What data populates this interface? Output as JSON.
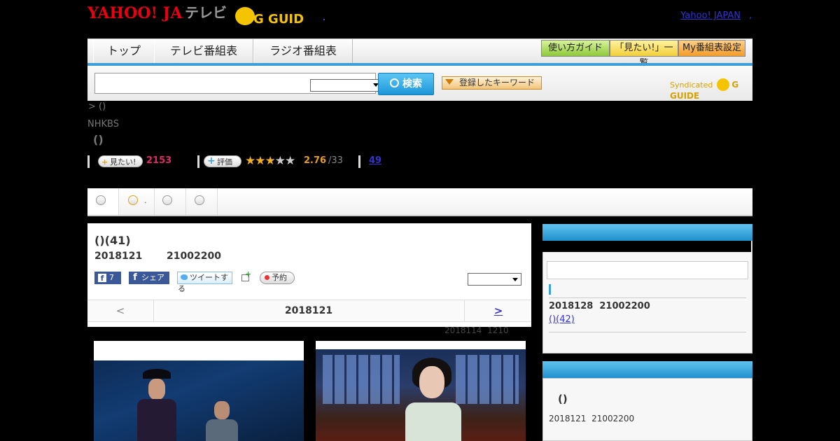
{
  "header": {
    "yahoo_logo": "YAHOO! JAPAN",
    "tv_label": "テレビ",
    "gguide_logo": "G GUIDE",
    "yahoo_japan_link": "Yahoo! JAPAN",
    "comma": ","
  },
  "nav": {
    "tabs": [
      {
        "label": "トップ"
      },
      {
        "label": "テレビ番組表"
      },
      {
        "label": "ラジオ番組表"
      }
    ],
    "guide_buttons": [
      {
        "label": "使い方ガイド"
      },
      {
        "label": "「見たい!」一覧"
      },
      {
        "label": "My番組表設定"
      }
    ]
  },
  "search": {
    "button_label": "検索",
    "keyword_button": "登録したキーワード",
    "syndicated": "Syndicated"
  },
  "breadcrumb": ">  ()",
  "channel": "NHKBS",
  "program_title": "()",
  "rating": {
    "mitai_label": "見たい!",
    "mitai_count": "2153",
    "hyoka_label": "評価",
    "stars": "★★★★★",
    "score": "2.76",
    "score_count": "/33",
    "review_count": "49"
  },
  "tabs_row": {
    "tab2_text": "."
  },
  "episode": {
    "title": "()(41)",
    "date": "2018121",
    "time": "21002200",
    "fb_like_count": "7",
    "fb_share_label": "シェア",
    "tweet_label": "ツイートする",
    "reserve_label": "予約",
    "prev": "<",
    "current_date": "2018121",
    "next": ">",
    "updated_date": "2018114",
    "updated_time": "1210"
  },
  "sidebar": {
    "next_date": "2018128",
    "next_time": "21002200",
    "next_link": "()(42)",
    "program_title": "()",
    "program_date": "2018121",
    "program_time": "21002200"
  },
  "colors": {
    "accent_blue": "#3ba0d8",
    "mitai_pink": "#e0276a",
    "score_orange": "#e6a017",
    "link_blue": "#3333cc"
  }
}
